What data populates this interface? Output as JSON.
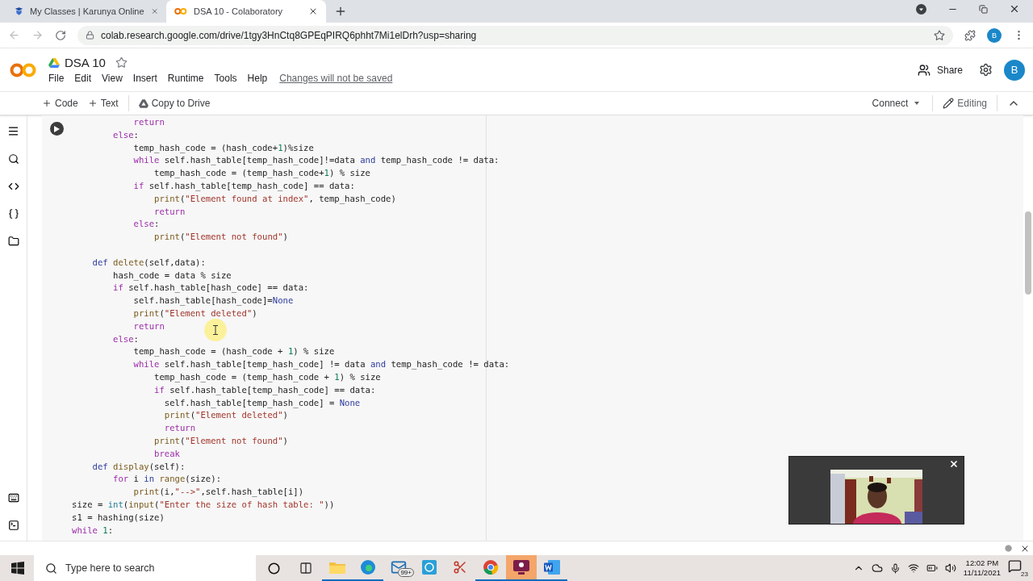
{
  "browser": {
    "tabs": [
      {
        "title": "My Classes | Karunya Online",
        "selected": false
      },
      {
        "title": "DSA 10 - Colaboratory",
        "selected": true
      }
    ],
    "url": "colab.research.google.com/drive/1tgy3HnCtq8GPEqPIRQ6phht7Mi1elDrh?usp=sharing",
    "avatar": "B"
  },
  "notebook": {
    "title": "DSA 10",
    "menu": [
      "File",
      "Edit",
      "View",
      "Insert",
      "Runtime",
      "Tools",
      "Help"
    ],
    "notice": "Changes will not be saved",
    "share": "Share",
    "avatar": "B"
  },
  "toolbar": {
    "add_code": "Code",
    "add_text": "Text",
    "copy": "Copy to Drive",
    "connect": "Connect",
    "mode": "Editing"
  },
  "code": {
    "lines": [
      {
        "tokens": [
          {
            "text": "            return",
            "kind": "keyword"
          }
        ]
      },
      {
        "tokens": [
          {
            "text": "        else",
            "kind": "keyword"
          },
          {
            "text": ":",
            "kind": "plain"
          }
        ]
      },
      {
        "tokens": [
          {
            "text": "            temp_hash_code = (hash_code+",
            "kind": "plain"
          },
          {
            "text": "1",
            "kind": "number"
          },
          {
            "text": ")%size",
            "kind": "plain"
          }
        ]
      },
      {
        "tokens": [
          {
            "text": "            while",
            "kind": "keyword"
          },
          {
            "text": " self.hash_table[temp_hash_code]!=data ",
            "kind": "plain"
          },
          {
            "text": "and",
            "kind": "operator"
          },
          {
            "text": " temp_hash_code != data:",
            "kind": "plain"
          }
        ]
      },
      {
        "tokens": [
          {
            "text": "                temp_hash_code = (temp_hash_code+",
            "kind": "plain"
          },
          {
            "text": "1",
            "kind": "number"
          },
          {
            "text": ") % size",
            "kind": "plain"
          }
        ]
      },
      {
        "tokens": [
          {
            "text": "            if",
            "kind": "keyword"
          },
          {
            "text": " self.hash_table[temp_hash_code] == data:",
            "kind": "plain"
          }
        ]
      },
      {
        "tokens": [
          {
            "text": "                print",
            "kind": "function"
          },
          {
            "text": "(",
            "kind": "plain"
          },
          {
            "text": "\"Element found at index\"",
            "kind": "string"
          },
          {
            "text": ", temp_hash_code)",
            "kind": "plain"
          }
        ]
      },
      {
        "tokens": [
          {
            "text": "                return",
            "kind": "keyword"
          }
        ]
      },
      {
        "tokens": [
          {
            "text": "            else",
            "kind": "keyword"
          },
          {
            "text": ":",
            "kind": "plain"
          }
        ]
      },
      {
        "tokens": [
          {
            "text": "                print",
            "kind": "function"
          },
          {
            "text": "(",
            "kind": "plain"
          },
          {
            "text": "\"Element not found\"",
            "kind": "string"
          },
          {
            "text": ")",
            "kind": "plain"
          }
        ]
      },
      {
        "gap_before": true,
        "tokens": [
          {
            "text": "    def",
            "kind": "operator"
          },
          {
            "text": " delete",
            "kind": "function"
          },
          {
            "text": "(self,data):",
            "kind": "plain"
          }
        ]
      },
      {
        "tokens": [
          {
            "text": "        hash_code = data % size",
            "kind": "plain"
          }
        ]
      },
      {
        "tokens": [
          {
            "text": "        if",
            "kind": "keyword"
          },
          {
            "text": " self.hash_table[hash_code] == data:",
            "kind": "plain"
          }
        ]
      },
      {
        "tokens": [
          {
            "text": "            self.hash_table[hash_code]=",
            "kind": "plain"
          },
          {
            "text": "None",
            "kind": "operator"
          }
        ]
      },
      {
        "tokens": [
          {
            "text": "            print",
            "kind": "function"
          },
          {
            "text": "(",
            "kind": "plain"
          },
          {
            "text": "\"Element deleted\"",
            "kind": "string"
          },
          {
            "text": ")",
            "kind": "plain"
          }
        ]
      },
      {
        "tokens": [
          {
            "text": "            return",
            "kind": "keyword"
          }
        ]
      },
      {
        "tokens": [
          {
            "text": "        else",
            "kind": "keyword"
          },
          {
            "text": ":",
            "kind": "plain"
          }
        ]
      },
      {
        "tokens": [
          {
            "text": "            temp_hash_code = (hash_code + ",
            "kind": "plain"
          },
          {
            "text": "1",
            "kind": "number"
          },
          {
            "text": ") % size",
            "kind": "plain"
          }
        ]
      },
      {
        "tokens": [
          {
            "text": "            while",
            "kind": "keyword"
          },
          {
            "text": " self.hash_table[temp_hash_code] != data ",
            "kind": "plain"
          },
          {
            "text": "and",
            "kind": "operator"
          },
          {
            "text": " temp_hash_code != data:",
            "kind": "plain"
          }
        ]
      },
      {
        "tokens": [
          {
            "text": "                temp_hash_code = (temp_hash_code + ",
            "kind": "plain"
          },
          {
            "text": "1",
            "kind": "number"
          },
          {
            "text": ") % size",
            "kind": "plain"
          }
        ]
      },
      {
        "tokens": [
          {
            "text": "                if",
            "kind": "keyword"
          },
          {
            "text": " self.hash_table[temp_hash_code] == data:",
            "kind": "plain"
          }
        ]
      },
      {
        "tokens": [
          {
            "text": "                  self.hash_table[temp_hash_code] = ",
            "kind": "plain"
          },
          {
            "text": "None",
            "kind": "operator"
          }
        ]
      },
      {
        "tokens": [
          {
            "text": "                  print",
            "kind": "function"
          },
          {
            "text": "(",
            "kind": "plain"
          },
          {
            "text": "\"Element deleted\"",
            "kind": "string"
          },
          {
            "text": ")",
            "kind": "plain"
          }
        ]
      },
      {
        "tokens": [
          {
            "text": "                  return",
            "kind": "keyword"
          }
        ]
      },
      {
        "tokens": [
          {
            "text": "                print",
            "kind": "function"
          },
          {
            "text": "(",
            "kind": "plain"
          },
          {
            "text": "\"Element not found\"",
            "kind": "string"
          },
          {
            "text": ")",
            "kind": "plain"
          }
        ]
      },
      {
        "tokens": [
          {
            "text": "                break",
            "kind": "keyword"
          }
        ]
      },
      {
        "tokens": [
          {
            "text": "    def",
            "kind": "operator"
          },
          {
            "text": " display",
            "kind": "function"
          },
          {
            "text": "(self):",
            "kind": "plain"
          }
        ]
      },
      {
        "tokens": [
          {
            "text": "        for",
            "kind": "keyword"
          },
          {
            "text": " i ",
            "kind": "plain"
          },
          {
            "text": "in",
            "kind": "operator"
          },
          {
            "text": " range",
            "kind": "function"
          },
          {
            "text": "(size):",
            "kind": "plain"
          }
        ]
      },
      {
        "tokens": [
          {
            "text": "            print",
            "kind": "function"
          },
          {
            "text": "(i,",
            "kind": "plain"
          },
          {
            "text": "\"-->\"",
            "kind": "string"
          },
          {
            "text": ",self.hash_table[i])",
            "kind": "plain"
          }
        ]
      },
      {
        "tokens": [
          {
            "text": "size = ",
            "kind": "plain"
          },
          {
            "text": "int",
            "kind": "builtin"
          },
          {
            "text": "(",
            "kind": "plain"
          },
          {
            "text": "input",
            "kind": "function"
          },
          {
            "text": "(",
            "kind": "plain"
          },
          {
            "text": "\"Enter the size of hash table: \"",
            "kind": "string"
          },
          {
            "text": "))",
            "kind": "plain"
          }
        ]
      },
      {
        "tokens": [
          {
            "text": "s1 = hashing(size)",
            "kind": "plain"
          }
        ]
      },
      {
        "tokens": [
          {
            "text": "while",
            "kind": "keyword"
          },
          {
            "text": " 1",
            "kind": "number"
          },
          {
            "text": ":",
            "kind": "plain"
          }
        ]
      }
    ]
  },
  "taskbar": {
    "search_placeholder": "Type here to search",
    "apps": [
      {
        "kind": "files",
        "running": true,
        "selected": false
      },
      {
        "kind": "edge",
        "running": true,
        "selected": false
      },
      {
        "kind": "mail",
        "running": false,
        "selected": false,
        "badge": "99+"
      },
      {
        "kind": "dell",
        "running": false,
        "selected": false
      },
      {
        "kind": "snip",
        "running": false,
        "selected": false
      },
      {
        "kind": "chrome",
        "running": true,
        "selected": false
      },
      {
        "kind": "meeting",
        "running": true,
        "selected": true
      },
      {
        "kind": "word",
        "running": true,
        "selected": false
      }
    ],
    "time": "12:02 PM",
    "date": "11/11/2021",
    "notifications": "23"
  }
}
